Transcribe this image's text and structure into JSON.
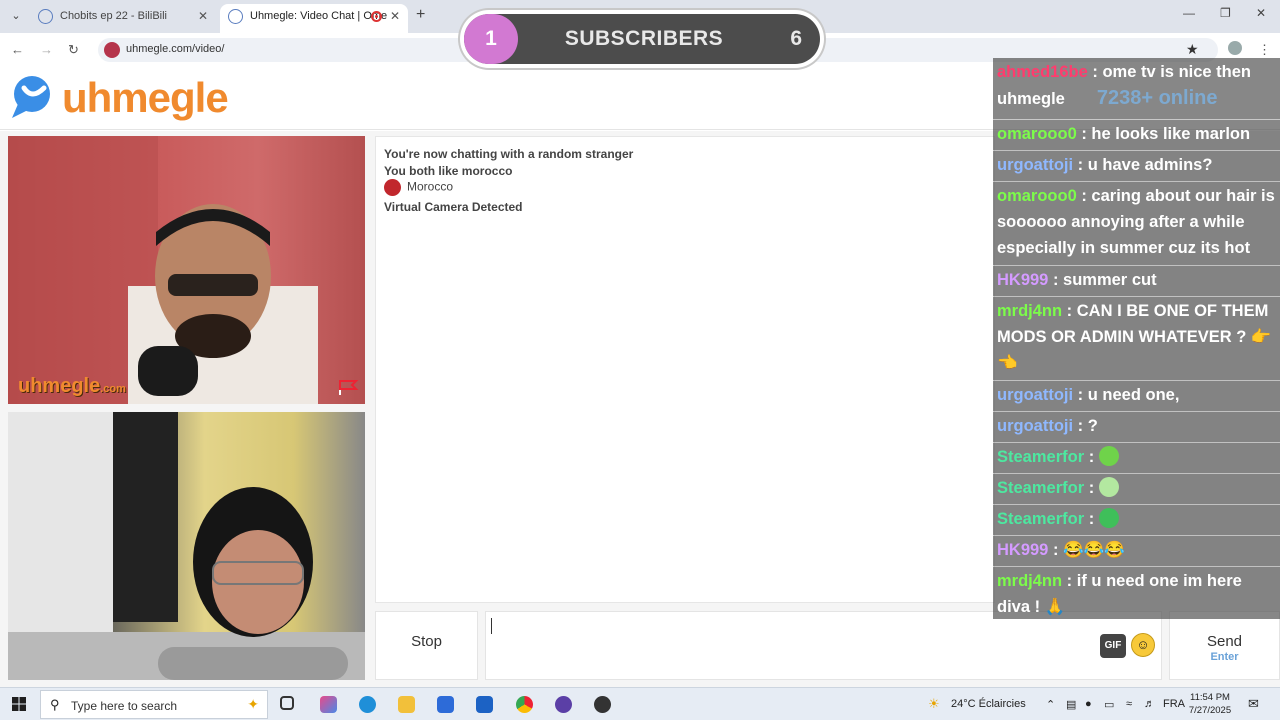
{
  "browser": {
    "tabs": [
      {
        "title": "Chobits ep 22 - BiliBili",
        "active": false
      },
      {
        "title": "Uhmegle: Video Chat | Ome",
        "active": true
      }
    ],
    "url": "uhmegle.com/video/"
  },
  "overlay": {
    "subscriber_count": "1",
    "subscriber_label": "SUBSCRIBERS",
    "subscriber_goal": "6"
  },
  "site": {
    "logo_text": "uhmegle",
    "watermark": "uhmegle",
    "watermark_suffix": ".com"
  },
  "chat_log": {
    "lines": [
      "You're now chatting with a random stranger",
      "You both like morocco"
    ],
    "country": "Morocco",
    "notice": "Virtual Camera Detected"
  },
  "controls": {
    "stop_label": "Stop",
    "gif_label": "GIF",
    "send_label": "Send",
    "send_hint": "Enter"
  },
  "stream_chat": [
    {
      "user": "ahmed16be",
      "color": "#ff3c6e",
      "text": " : ome tv is nice then uhmegle",
      "extra": "7238+ online"
    },
    {
      "user": "omarooo0",
      "color": "#7cfc4a",
      "text": " : he looks like marlon"
    },
    {
      "user": "urgoattoji",
      "color": "#8fb8ff",
      "text": " : u have admins?"
    },
    {
      "user": "omarooo0",
      "color": "#7cfc4a",
      "text": " : caring about our hair is soooooo annoying after a while especially in summer cuz its hot"
    },
    {
      "user": "HK999",
      "color": "#d49bff",
      "text": " : summer cut"
    },
    {
      "user": "mrdj4nn",
      "color": "#7cfc4a",
      "text": " : CAN I BE ONE OF THEM MODS OR ADMIN WHATEVER ? 👉 👈"
    },
    {
      "user": "urgoattoji",
      "color": "#8fb8ff",
      "text": " : u need one,"
    },
    {
      "user": "urgoattoji",
      "color": "#8fb8ff",
      "text": " : ?"
    },
    {
      "user": "Steamerfor",
      "color": "#4de8a0",
      "text": " : "
    },
    {
      "user": "Steamerfor",
      "color": "#4de8a0",
      "text": " : "
    },
    {
      "user": "Steamerfor",
      "color": "#4de8a0",
      "text": " : "
    },
    {
      "user": "HK999",
      "color": "#d49bff",
      "text": " : 😂😂😂"
    },
    {
      "user": "mrdj4nn",
      "color": "#7cfc4a",
      "text": " : if u need one im here diva ! 🙏"
    }
  ],
  "taskbar": {
    "search_placeholder": "Type here to search",
    "weather": "24°C  Éclaircies",
    "language": "FRA",
    "time": "11:54 PM",
    "date": "7/27/2025"
  },
  "colors": {
    "brand_orange": "#f08a2e",
    "brand_blue": "#3a8ee6",
    "subscriber_accent": "#d279d2"
  }
}
